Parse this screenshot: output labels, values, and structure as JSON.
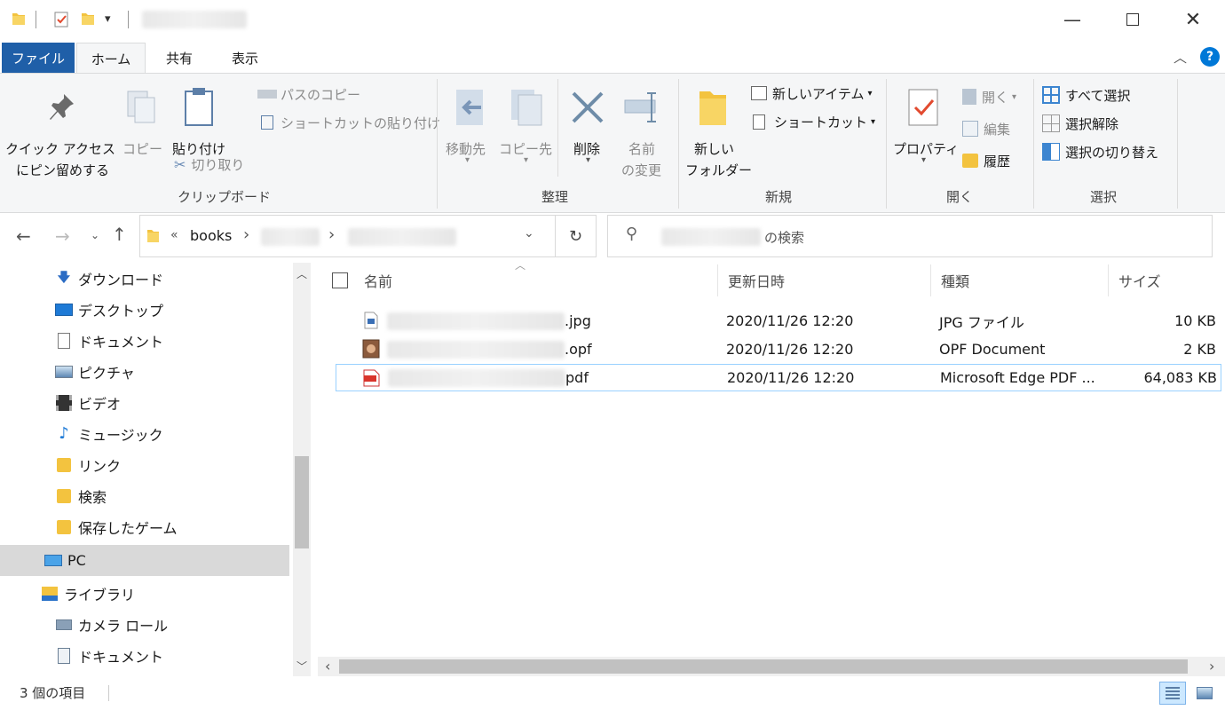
{
  "ribbon": {
    "tabs": [
      "ファイル",
      "ホーム",
      "共有",
      "表示"
    ],
    "clipboard": {
      "pin_line1": "クイック アクセス",
      "pin_line2": "にピン留めする",
      "copy": "コピー",
      "paste": "貼り付け",
      "copy_path": "パスのコピー",
      "paste_shortcut": "ショートカットの貼り付け",
      "cut": "切り取り",
      "group": "クリップボード"
    },
    "organize": {
      "move_to": "移動先",
      "copy_to": "コピー先",
      "delete": "削除",
      "rename_line1": "名前",
      "rename_line2": "の変更",
      "group": "整理"
    },
    "new": {
      "new_item": "新しいアイテム",
      "shortcut": "ショートカット",
      "folder_line1": "新しい",
      "folder_line2": "フォルダー",
      "group": "新規"
    },
    "open": {
      "properties": "プロパティ",
      "open": "開く",
      "edit": "編集",
      "history": "履歴",
      "group": "開く"
    },
    "select": {
      "select_all": "すべて選択",
      "select_none": "選択解除",
      "invert": "選択の切り替え",
      "group": "選択"
    }
  },
  "address": {
    "prefix": "«",
    "crumb1": "books",
    "sep": "›"
  },
  "search": {
    "placeholder_suffix": "の検索"
  },
  "nav_items": [
    {
      "label": "ダウンロード",
      "icon": "download-icon"
    },
    {
      "label": "デスクトップ",
      "icon": "desktop-icon"
    },
    {
      "label": "ドキュメント",
      "icon": "documents-icon"
    },
    {
      "label": "ピクチャ",
      "icon": "pictures-icon"
    },
    {
      "label": "ビデオ",
      "icon": "videos-icon"
    },
    {
      "label": "ミュージック",
      "icon": "music-icon"
    },
    {
      "label": "リンク",
      "icon": "links-icon"
    },
    {
      "label": "検索",
      "icon": "searches-icon"
    },
    {
      "label": "保存したゲーム",
      "icon": "saved-games-icon"
    },
    {
      "label": "PC",
      "icon": "pc-icon"
    },
    {
      "label": "ライブラリ",
      "icon": "library-icon"
    },
    {
      "label": "カメラ ロール",
      "icon": "camera-roll-icon"
    },
    {
      "label": "ドキュメント",
      "icon": "library-documents-icon"
    }
  ],
  "columns": {
    "name": "名前",
    "modified": "更新日時",
    "type": "種類",
    "size": "サイズ"
  },
  "files": [
    {
      "ext": ".jpg",
      "modified": "2020/11/26 12:20",
      "type": "JPG ファイル",
      "size": "10 KB"
    },
    {
      "ext": ".opf",
      "modified": "2020/11/26 12:20",
      "type": "OPF Document",
      "size": "2 KB"
    },
    {
      "ext": "pdf",
      "modified": "2020/11/26 12:20",
      "type": "Microsoft Edge PDF ...",
      "size": "64,083 KB"
    }
  ],
  "status": {
    "count": "3 個の項目"
  },
  "colors": {
    "file_tab": "#1f5fa8",
    "accent": "#0078d7",
    "selected_nav": "#d9d9d9"
  }
}
